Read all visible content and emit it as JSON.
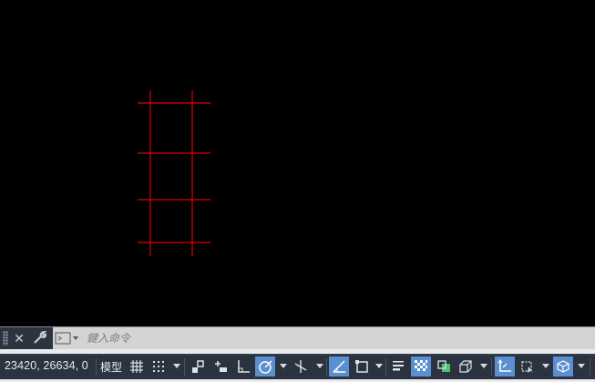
{
  "commandline": {
    "placeholder": "鍵入命令",
    "close_icon": "close-icon",
    "customize_icon": "wrench-icon",
    "prompt_icon": "command-prompt-icon"
  },
  "statusbar": {
    "coordinates": "23420, 26634, 0",
    "model_label": "模型",
    "buttons": [
      {
        "name": "grid-icon",
        "active": false
      },
      {
        "name": "snap-mode-icon",
        "active": false
      },
      {
        "name": "infer-constraints-icon",
        "active": false
      },
      {
        "name": "dynamic-input-icon",
        "active": false
      },
      {
        "name": "ortho-mode-icon",
        "active": false
      },
      {
        "name": "polar-tracking-icon",
        "active": true
      },
      {
        "name": "isometric-drafting-icon",
        "active": false
      },
      {
        "name": "object-snap-tracking-icon",
        "active": true
      },
      {
        "name": "object-snap-icon",
        "active": false
      },
      {
        "name": "lineweight-icon",
        "active": false
      },
      {
        "name": "transparency-icon",
        "active": true
      },
      {
        "name": "selection-cycling-icon",
        "active": false
      },
      {
        "name": "3d-object-snap-icon",
        "active": false
      },
      {
        "name": "dynamic-ucs-icon",
        "active": true
      },
      {
        "name": "selection-filter-icon",
        "active": false
      },
      {
        "name": "gizmo-icon",
        "active": true
      }
    ]
  },
  "colors": {
    "canvas_background": "#000000",
    "drawing_lines": "#ff0000",
    "active_button": "#5a8fd0",
    "statusbar_background": "#2b3240"
  }
}
